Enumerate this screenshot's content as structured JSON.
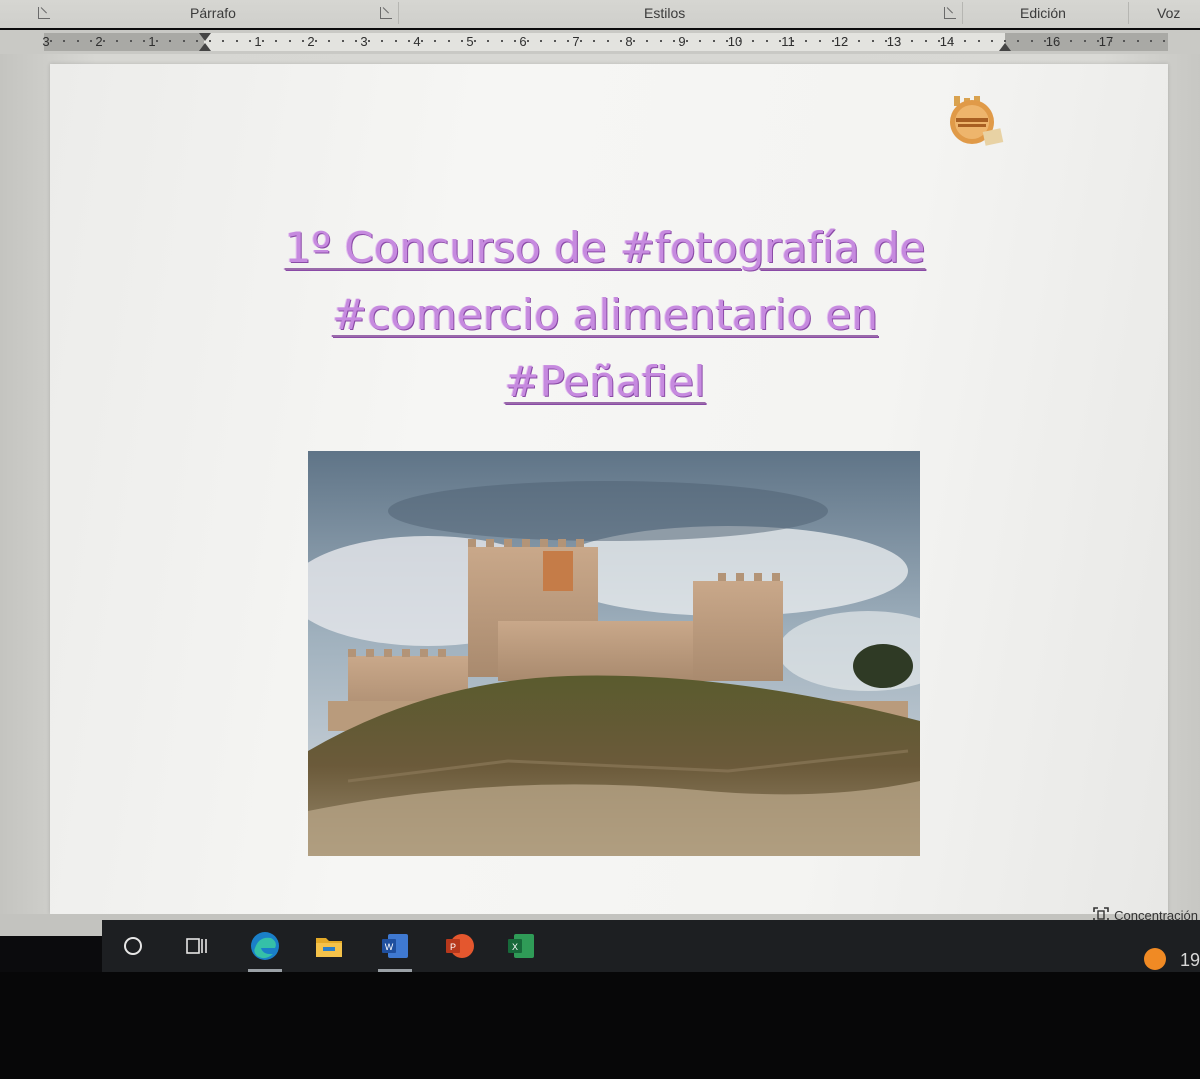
{
  "ribbon": {
    "groups": [
      {
        "label": "Párrafo"
      },
      {
        "label": "Estilos"
      },
      {
        "label": "Edición"
      },
      {
        "label": "Voz"
      }
    ]
  },
  "ruler": {
    "left_numbers": [
      "3",
      "2",
      "1"
    ],
    "right_numbers": [
      "1",
      "2",
      "3",
      "4",
      "5",
      "6",
      "7",
      "8",
      "9",
      "10",
      "11",
      "12",
      "13",
      "14",
      "16",
      "17"
    ]
  },
  "document": {
    "title_lines": [
      "1º Concurso de #fotografía de",
      "#comercio alimentario en",
      "#Peñafiel"
    ],
    "logo_icon": "conde-lucanor-logo",
    "image_icon": "penafiel-castle-photo"
  },
  "status": {
    "focus_label": "Concentración"
  },
  "taskbar": {
    "apps": [
      {
        "icon": "cortana-icon"
      },
      {
        "icon": "task-view-icon"
      },
      {
        "icon": "edge-icon"
      },
      {
        "icon": "file-explorer-icon"
      },
      {
        "icon": "word-icon"
      },
      {
        "icon": "powerpoint-icon"
      },
      {
        "icon": "excel-icon"
      }
    ],
    "clock_partial": "19"
  },
  "colors": {
    "title": "#c68adf",
    "taskbar": "#1d1f22",
    "ruler": "#e3e3df"
  }
}
